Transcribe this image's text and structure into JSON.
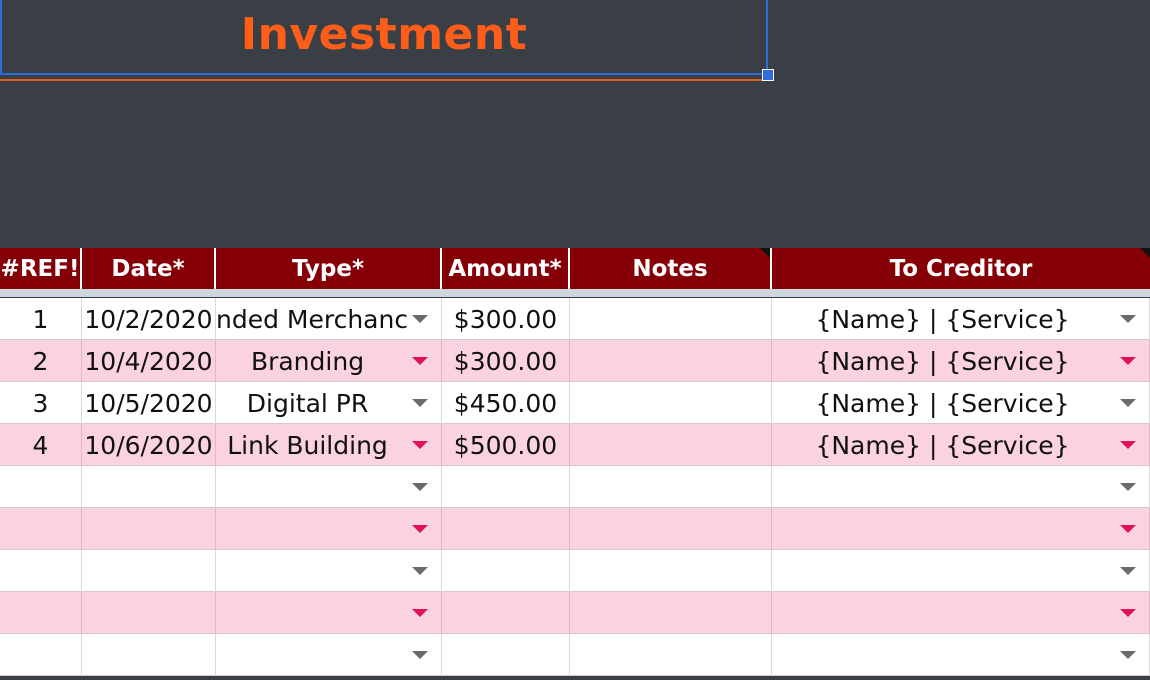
{
  "title": "Investment",
  "headers": {
    "ref": "#REF!",
    "date": "Date*",
    "type": "Type*",
    "amount": "Amount*",
    "notes": "Notes",
    "creditor": "To Creditor"
  },
  "rows": [
    {
      "num": "1",
      "date": "10/2/2020",
      "type": "nded Merchanc",
      "amount": "$300.00",
      "notes": "",
      "creditor": "{Name} | {Service}"
    },
    {
      "num": "2",
      "date": "10/4/2020",
      "type": "Branding",
      "amount": "$300.00",
      "notes": "",
      "creditor": "{Name} | {Service}"
    },
    {
      "num": "3",
      "date": "10/5/2020",
      "type": "Digital PR",
      "amount": "$450.00",
      "notes": "",
      "creditor": "{Name} | {Service}"
    },
    {
      "num": "4",
      "date": "10/6/2020",
      "type": "Link Building",
      "amount": "$500.00",
      "notes": "",
      "creditor": "{Name} | {Service}"
    },
    {
      "num": "",
      "date": "",
      "type": "",
      "amount": "",
      "notes": "",
      "creditor": ""
    },
    {
      "num": "",
      "date": "",
      "type": "",
      "amount": "",
      "notes": "",
      "creditor": ""
    },
    {
      "num": "",
      "date": "",
      "type": "",
      "amount": "",
      "notes": "",
      "creditor": ""
    },
    {
      "num": "",
      "date": "",
      "type": "",
      "amount": "",
      "notes": "",
      "creditor": ""
    },
    {
      "num": "",
      "date": "",
      "type": "",
      "amount": "",
      "notes": "",
      "creditor": ""
    }
  ],
  "colors": {
    "header_bg": "#850006",
    "title_color": "#ff5e1a",
    "banner_bg": "#3a3e45",
    "pink_row": "#fad2e0",
    "white_row": "#ffffff",
    "dropdown_pink": "#e0105a",
    "dropdown_grey": "#6b6b6b",
    "selection_blue": "#2f6de1"
  },
  "icons": {
    "dropdown": "triangle-down",
    "note_indicator": "corner-triangle"
  }
}
